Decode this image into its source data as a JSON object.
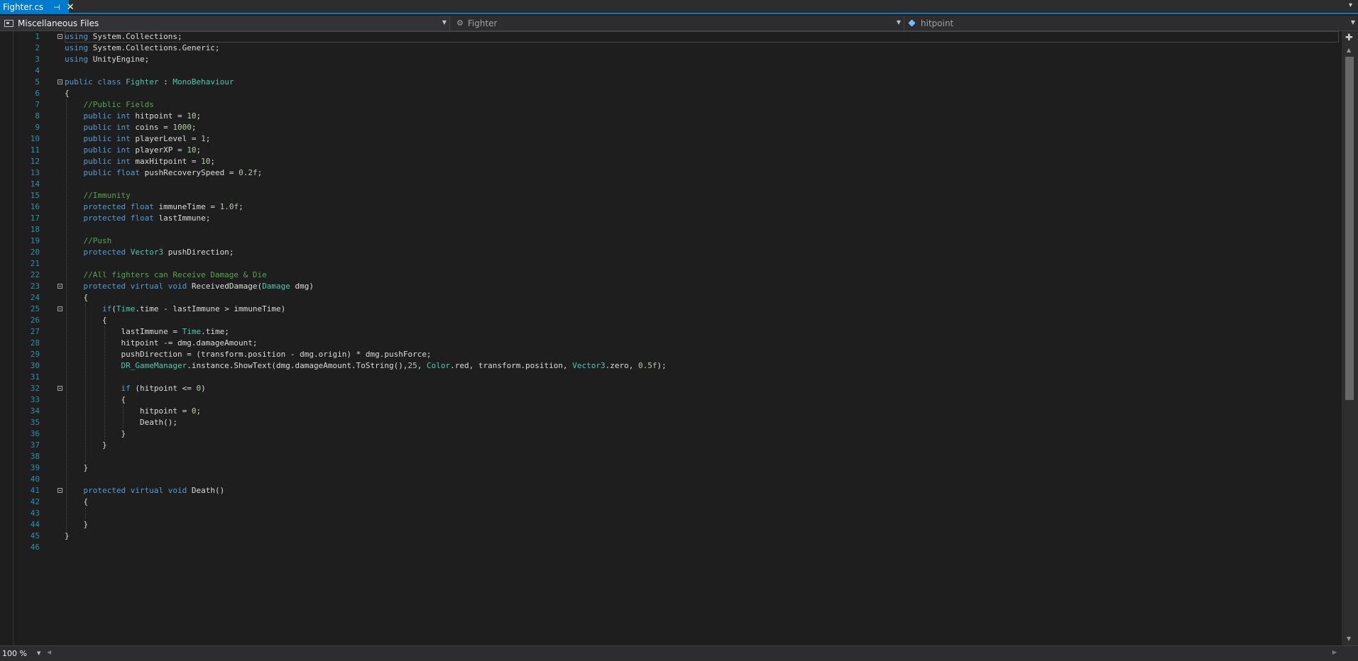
{
  "tab": {
    "title": "Fighter.cs",
    "pin": "⊣",
    "close": "✕"
  },
  "navbar": {
    "project": "Miscellaneous Files",
    "type": "Fighter",
    "member": "hitpoint"
  },
  "zoom": {
    "value": "100 %"
  },
  "code_lines": [
    "using System.Collections;",
    "using System.Collections.Generic;",
    "using UnityEngine;",
    "",
    "public class Fighter : MonoBehaviour",
    "{",
    "    //Public Fields",
    "    public int hitpoint = 10;",
    "    public int coins = 1000;",
    "    public int playerLevel = 1;",
    "    public int playerXP = 10;",
    "    public int maxHitpoint = 10;",
    "    public float pushRecoverySpeed = 0.2f;",
    "",
    "    //Immunity",
    "    protected float immuneTime = 1.0f;",
    "    protected float lastImmune;",
    "",
    "    //Push",
    "    protected Vector3 pushDirection;",
    "",
    "    //All fighters can Receive Damage & Die",
    "    protected virtual void ReceivedDamage(Damage dmg)",
    "    {",
    "        if(Time.time - lastImmune > immuneTime)",
    "        {",
    "            lastImmune = Time.time;",
    "            hitpoint -= dmg.damageAmount;",
    "            pushDirection = (transform.position - dmg.origin) * dmg.pushForce;",
    "            DR_GameManager.instance.ShowText(dmg.damageAmount.ToString(),25, Color.red, transform.position, Vector3.zero, 0.5f);",
    "",
    "            if (hitpoint <= 0)",
    "            {",
    "                hitpoint = 0;",
    "                Death();",
    "            }",
    "        }",
    "",
    "    }",
    "",
    "    protected virtual void Death()",
    "    {",
    "",
    "    }",
    "}",
    ""
  ],
  "fold_lines": [
    1,
    5,
    23,
    25,
    32,
    41
  ],
  "syntax_colors": {
    "keyword": "#569cd6",
    "type": "#4ec9b0",
    "comment": "#57a64a",
    "number": "#b5cea8",
    "line_number": "#2b91af",
    "text": "#dcdcdc",
    "accent": "#007acc"
  }
}
